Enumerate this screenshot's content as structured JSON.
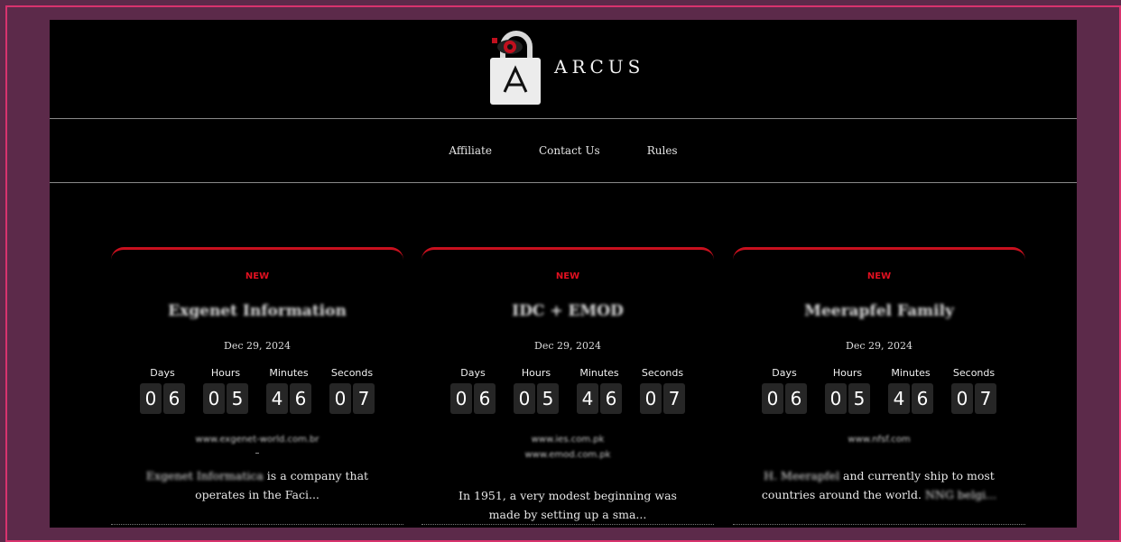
{
  "brand": {
    "name": "ARCUS"
  },
  "nav": {
    "items": [
      "Affiliate",
      "Contact Us",
      "Rules"
    ]
  },
  "countdown_labels": {
    "days": "Days",
    "hours": "Hours",
    "minutes": "Minutes",
    "seconds": "Seconds"
  },
  "cards": [
    {
      "badge": "NEW",
      "title": "Exgenet Information",
      "date": "Dec 29, 2024",
      "countdown": {
        "days": "06",
        "hours": "05",
        "minutes": "46",
        "seconds": "07"
      },
      "website": "www.exgenet-world.com.br",
      "separator": "–",
      "desc_blurred": "Exgenet Informatica",
      "desc_rest": " is a company that operates in the Faci..."
    },
    {
      "badge": "NEW",
      "title": "IDC + EMOD",
      "date": "Dec 29, 2024",
      "countdown": {
        "days": "06",
        "hours": "05",
        "minutes": "46",
        "seconds": "07"
      },
      "website": "www.ies.com.pk",
      "website2": "www.emod.com.pk",
      "desc_rest": "In 1951, a very modest beginning was made by setting up a sma..."
    },
    {
      "badge": "NEW",
      "title": "Meerapfel Family",
      "date": "Dec 29, 2024",
      "countdown": {
        "days": "06",
        "hours": "05",
        "minutes": "46",
        "seconds": "07"
      },
      "website": "www.nfsf.com",
      "desc_blurred": "H. Meerapfel",
      "desc_rest": " and currently ship to most countries around the world.",
      "desc_tail_blurred": " NNG belgi..."
    }
  ]
}
